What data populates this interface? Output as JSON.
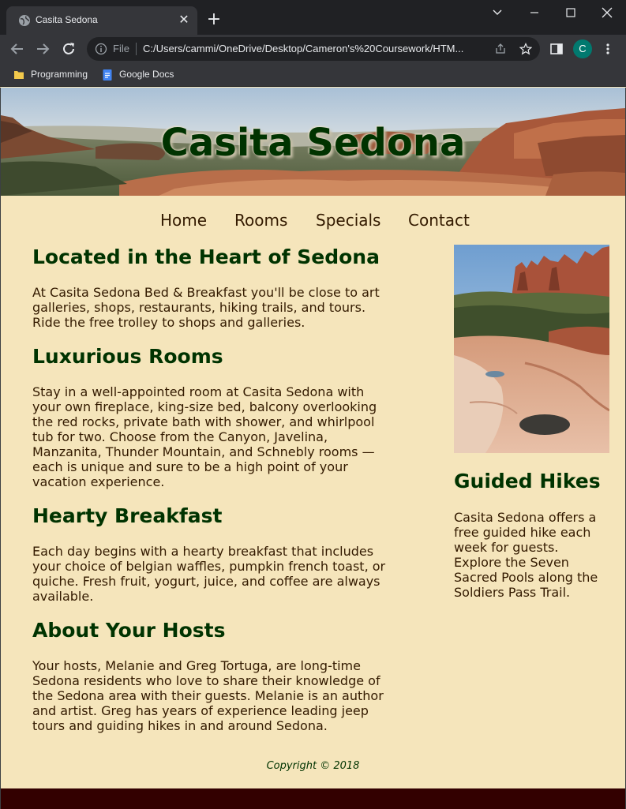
{
  "browser": {
    "tab_title": "Casita Sedona",
    "tab_close": "✕",
    "new_tab": "+",
    "omnibox_scheme": "File",
    "url": "C:/Users/cammi/OneDrive/Desktop/Cameron's%20Coursework/HTM...",
    "avatar_initial": "C",
    "avatar_color": "#01796f",
    "bookmarks": [
      {
        "label": "Programming",
        "icon": "folder-icon"
      },
      {
        "label": "Google Docs",
        "icon": "google-docs-icon"
      }
    ]
  },
  "site": {
    "title": "Casita Sedona",
    "nav": [
      "Home",
      "Rooms",
      "Specials",
      "Contact"
    ],
    "sections": [
      {
        "heading": "Located in the Heart of Sedona",
        "lines": [
          "At Casita Sedona Bed & Breakfast you'll be close to art",
          "galleries, shops, restaurants, hiking trails, and tours.",
          "Ride the free trolley to shops and galleries."
        ]
      },
      {
        "heading": "Luxurious Rooms",
        "lines": [
          "Stay in a well-appointed room at Casita Sedona with",
          "your own fireplace, king-size bed, balcony overlooking",
          "the red rocks, private bath with shower, and whirlpool",
          "tub for two. Choose from the Canyon, Javelina,",
          "Manzanita, Thunder Mountain, and Schnebly rooms —",
          "each is unique and sure to be a high point of your",
          "vacation experience."
        ]
      },
      {
        "heading": "Hearty Breakfast",
        "lines": [
          "Each day begins with a hearty breakfast that includes",
          "your choice of belgian waffles, pumpkin french toast, or",
          "quiche. Fresh fruit, yogurt, juice, and coffee are always",
          "available."
        ]
      },
      {
        "heading": "About Your Hosts",
        "lines": [
          "Your hosts, Melanie and Greg Tortuga, are long-time",
          "Sedona residents who love to share their knowledge of",
          "the Sedona area with their guests. Melanie is an author",
          "and artist. Greg has years of experience leading jeep",
          "tours and guiding hikes in and around Sedona."
        ]
      }
    ],
    "aside": {
      "heading": "Guided Hikes",
      "lines": [
        "Casita Sedona offers a",
        "free guided hike each",
        "week for guests.",
        "Explore the Seven",
        "Sacred Pools along the",
        "Soldiers Pass Trail."
      ]
    },
    "footer": "Copyright © 2018",
    "colors": {
      "background": "#f5e5bb",
      "heading": "#003300",
      "text": "#331a00",
      "bottom_bar": "#330000"
    }
  }
}
